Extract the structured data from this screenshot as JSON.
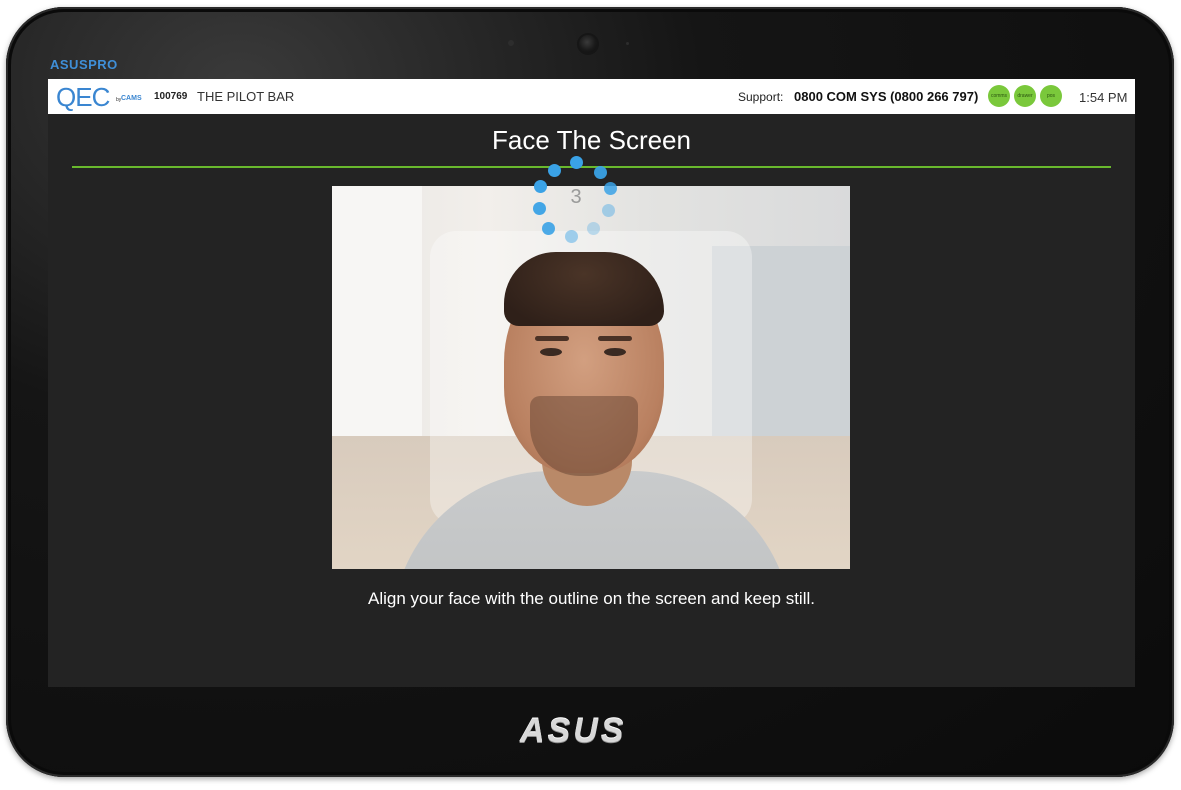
{
  "device": {
    "brand_top": "ASUSPRO",
    "brand_bottom": "ASUS"
  },
  "topbar": {
    "logo_text": "QEC",
    "logo_by": "by",
    "logo_company": "CAMS",
    "site_id": "100769",
    "site_name": "THE PILOT BAR",
    "support_label": "Support:",
    "support_phone": "0800 COM SYS (0800 266 797)",
    "status_indicators": [
      {
        "label": "comms",
        "color": "#7ac83b"
      },
      {
        "label": "drawer",
        "color": "#7ac83b"
      },
      {
        "label": "pos",
        "color": "#7ac83b"
      }
    ],
    "clock": "1:54 PM"
  },
  "main": {
    "title": "Face The Screen",
    "countdown": "3",
    "instruction": "Align your face with the outline on the screen and keep still."
  },
  "colors": {
    "accent_green": "#69b92d",
    "spinner_blue": "#3aa2e6",
    "logo_blue": "#3a86d1",
    "screen_bg": "#232323"
  }
}
